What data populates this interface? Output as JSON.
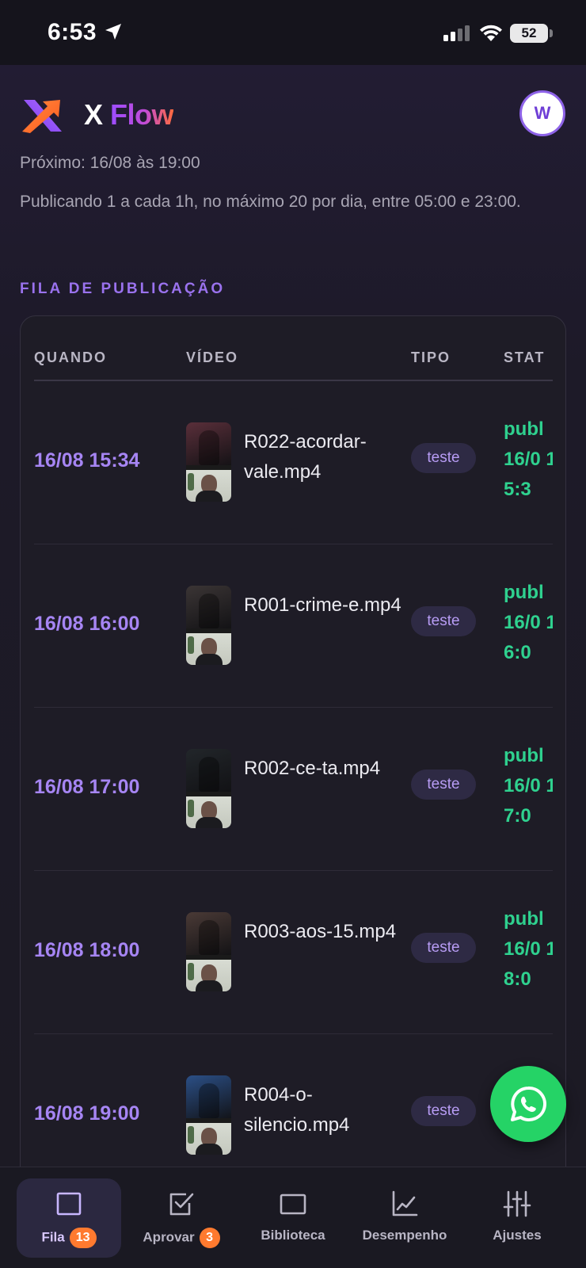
{
  "status_bar": {
    "time": "6:53",
    "battery": "52",
    "icons": [
      "location-arrow-icon",
      "signal-icon",
      "wifi-icon",
      "battery-icon"
    ]
  },
  "header": {
    "brand_x": "X",
    "brand_flow": "Flow",
    "avatar_initial": "W"
  },
  "schedule": {
    "next": "Próximo: 16/08 às 19:00",
    "rule": "Publicando 1 a cada 1h, no máximo 20 por dia, entre 05:00 e 23:00."
  },
  "queue": {
    "section_title": "FILA DE PUBLICAÇÃO",
    "columns": [
      "QUANDO",
      "VÍDEO",
      "TIPO",
      "STAT"
    ],
    "rows": [
      {
        "when": "16/08 15:34",
        "video": "R022-acordar-vale.mp4",
        "type": "teste",
        "status": "publ 16/0 15:3",
        "thumb_color": "#5a2f3a"
      },
      {
        "when": "16/08 16:00",
        "video": "R001-crime-e.mp4",
        "type": "teste",
        "status": "publ 16/0 16:0",
        "thumb_color": "#3b3535"
      },
      {
        "when": "16/08 17:00",
        "video": "R002-ce-ta.mp4",
        "type": "teste",
        "status": "publ 16/0 17:0",
        "thumb_color": "#22262a"
      },
      {
        "when": "16/08 18:00",
        "video": "R003-aos-15.mp4",
        "type": "teste",
        "status": "publ 16/0 18:0",
        "thumb_color": "#4a3a36"
      },
      {
        "when": "16/08 19:00",
        "video": "R004-o-silencio.mp4",
        "type": "teste",
        "status": "",
        "thumb_color": "#2b4f86"
      }
    ]
  },
  "nav": {
    "items": [
      {
        "label": "Fila",
        "badge": "13",
        "icon": "square-icon"
      },
      {
        "label": "Aprovar",
        "badge": "3",
        "icon": "checkbox-icon"
      },
      {
        "label": "Biblioteca",
        "badge": "",
        "icon": "library-icon"
      },
      {
        "label": "Desempenho",
        "badge": "",
        "icon": "chart-icon"
      },
      {
        "label": "Ajustes",
        "badge": "",
        "icon": "sliders-icon"
      }
    ]
  },
  "colors": {
    "accent": "#9a72ee",
    "status_green": "#2fd18f",
    "badge_orange": "#ff7a2f",
    "whatsapp": "#25d366"
  }
}
